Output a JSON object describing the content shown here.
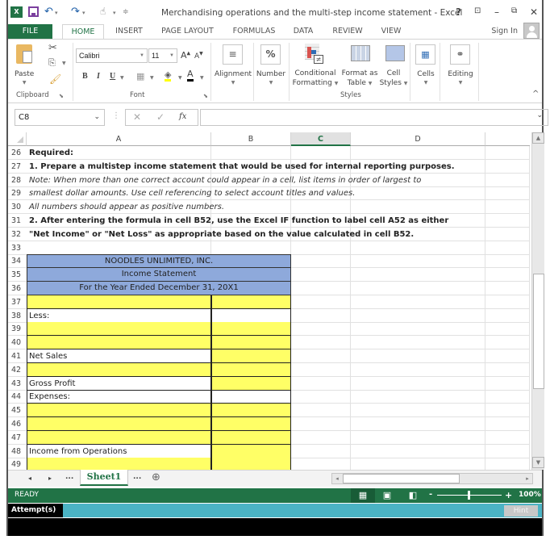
{
  "window": {
    "title": "Merchandising operations and the multi-step income statement - Excel",
    "help": "?",
    "restore_ribbon": "⊡",
    "minimize": "–",
    "maximize": "🗗",
    "close": "✕"
  },
  "quick_access": {
    "undo": "↶",
    "redo": "↷",
    "touch": "☝",
    "customize": "▾"
  },
  "tabs": [
    {
      "label": "FILE"
    },
    {
      "label": "HOME"
    },
    {
      "label": "INSERT"
    },
    {
      "label": "PAGE LAYOUT"
    },
    {
      "label": "FORMULAS"
    },
    {
      "label": "DATA"
    },
    {
      "label": "REVIEW"
    },
    {
      "label": "VIEW"
    }
  ],
  "sign_in": "Sign In",
  "ribbon": {
    "clipboard": {
      "paste": "Paste",
      "group": "Clipboard"
    },
    "font": {
      "name": "Calibri",
      "size": "11",
      "bold": "B",
      "italic": "I",
      "underline": "U",
      "group": "Font",
      "grow": "A",
      "shrink": "A",
      "font_color": "A"
    },
    "alignment": {
      "label": "Alignment"
    },
    "number": {
      "label": "Number",
      "icon": "%"
    },
    "styles": {
      "conditional_line1": "Conditional",
      "conditional_line2": "Formatting",
      "format_table_line1": "Format as",
      "format_table_line2": "Table",
      "cell_styles_line1": "Cell",
      "cell_styles_line2": "Styles",
      "group": "Styles"
    },
    "cells": {
      "label": "Cells"
    },
    "editing": {
      "label": "Editing"
    },
    "collapse": "^"
  },
  "formula_bar": {
    "name_box": "C8",
    "cancel": "✕",
    "enter": "✓",
    "fx": "fx",
    "value": ""
  },
  "columns": [
    "A",
    "B",
    "C",
    "D"
  ],
  "selected_column": "C",
  "rows": {
    "r26": {
      "num": "26",
      "text": "Required:"
    },
    "r27": {
      "num": "27",
      "text": "1.  Prepare a multistep income statement that would be used for internal reporting purposes."
    },
    "r28": {
      "num": "28",
      "text": "Note:  When more than one correct account could appear in a cell, list items in order of largest to"
    },
    "r29": {
      "num": "29",
      "text": "smallest dollar amounts.  Use cell referencing to select account titles and values."
    },
    "r30": {
      "num": "30",
      "text": "All numbers should appear as positive numbers."
    },
    "r31": {
      "num": "31",
      "text": "2. After entering the formula in cell B52, use the Excel IF function to label cell A52 as either"
    },
    "r32": {
      "num": "32",
      "text": " \"Net Income\" or \"Net Loss\" as appropriate based on the value calculated in cell B52."
    },
    "r33": {
      "num": "33",
      "text": ""
    },
    "r34": {
      "num": "34",
      "text": "NOODLES UNLIMITED, INC."
    },
    "r35": {
      "num": "35",
      "text": "Income Statement"
    },
    "r36": {
      "num": "36",
      "text": "For the Year Ended December 31, 20X1"
    },
    "r37": {
      "num": "37",
      "text": ""
    },
    "r38": {
      "num": "38",
      "text": "Less:"
    },
    "r39": {
      "num": "39",
      "text": ""
    },
    "r40": {
      "num": "40",
      "text": ""
    },
    "r41": {
      "num": "41",
      "text": "Net Sales"
    },
    "r42": {
      "num": "42",
      "text": ""
    },
    "r43": {
      "num": "43",
      "text": "Gross Profit"
    },
    "r44": {
      "num": "44",
      "text": "Expenses:"
    },
    "r45": {
      "num": "45",
      "text": ""
    },
    "r46": {
      "num": "46",
      "text": ""
    },
    "r47": {
      "num": "47",
      "text": ""
    },
    "r48": {
      "num": "48",
      "text": "Income from Operations"
    },
    "r49": {
      "num": "49",
      "text": ""
    }
  },
  "sheets": {
    "prev": "◂",
    "next": "▸",
    "more_left": "...",
    "active": "Sheet1",
    "more_right": "...",
    "add": "⊕"
  },
  "status": {
    "ready": "READY",
    "zoom": "100%",
    "zoom_minus": "-",
    "zoom_plus": "+",
    "zoom_level_percent": 100
  },
  "attempts": {
    "label": "Attempt(s)",
    "hint": "Hint"
  },
  "colors": {
    "excel_green": "#217346",
    "header_blue": "#8ea9db",
    "input_yellow": "#ffff66",
    "attempt_teal": "#4bb3c4"
  }
}
